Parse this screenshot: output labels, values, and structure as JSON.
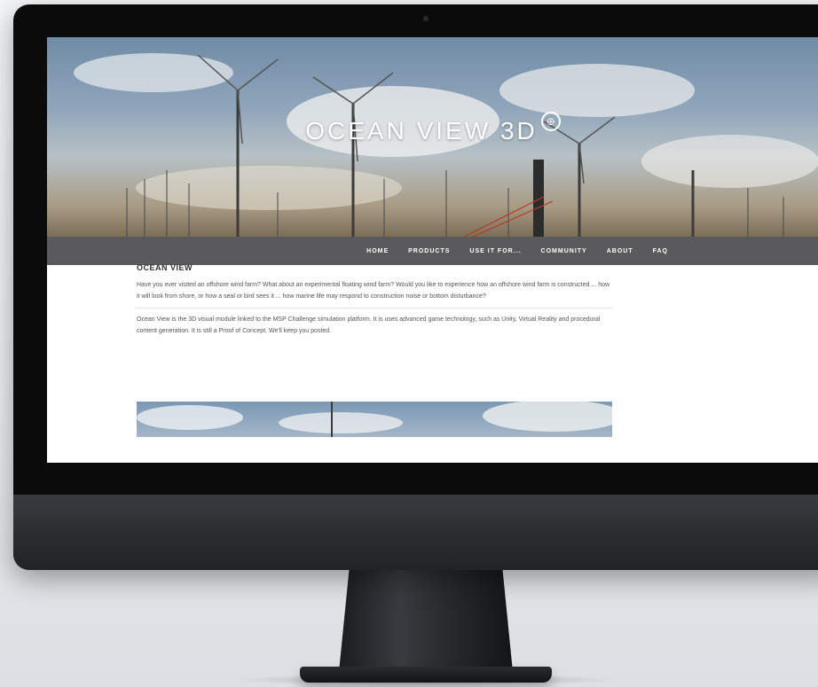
{
  "site": {
    "title": "OCEAN VIEW 3D",
    "logo_mark": "⊕"
  },
  "nav": {
    "items": [
      "HOME",
      "PRODUCTS",
      "USE IT FOR...",
      "COMMUNITY",
      "ABOUT",
      "FAQ"
    ]
  },
  "article": {
    "heading": "OCEAN VIEW",
    "paragraph1": "Have you ever visited an offshore wind farm? What about an experimental floating wind farm? Would you like to experience how an offshore wind farm is constructed ... how it will look from shore, or how a seal or bird sees it ... how marine life may respond to construction noise or bottom disturbance?",
    "paragraph2": "Ocean View is the 3D visual module linked to the MSP Challenge simulation platform. It is uses advanced game technology, such as Unity, Virtual Reality and procedural content generation. It is still a Proof of Concept. We'll keep you posted."
  },
  "colors": {
    "nav_background": "#5a5a5c",
    "monitor_bezel": "#0b0b0c"
  }
}
